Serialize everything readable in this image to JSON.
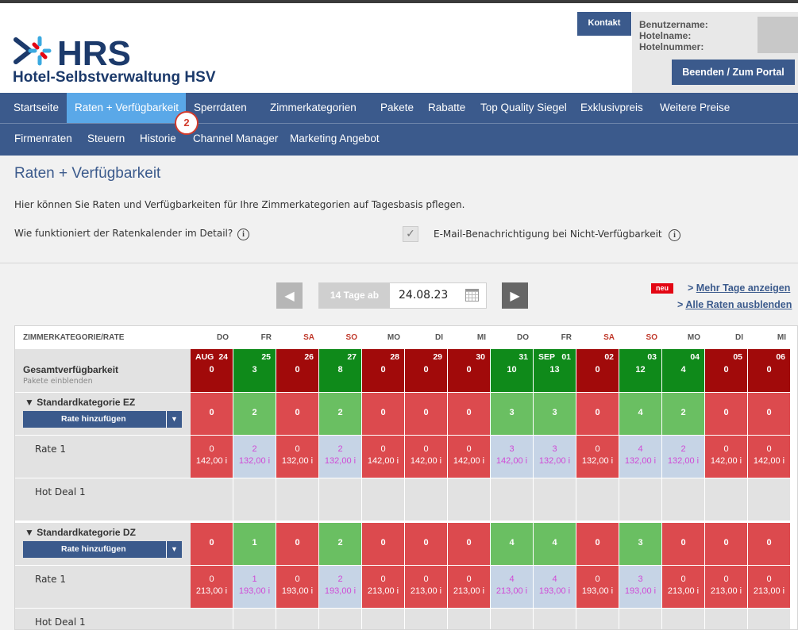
{
  "header": {
    "logo_text": "HRS",
    "brand_title": "Hotel-Selbstverwaltung HSV",
    "kontakt_label": "Kontakt",
    "user_labels": [
      "Benutzername:",
      "Hotelname:",
      "Hotelnummer:"
    ],
    "logout_label": "Beenden / Zum Portal"
  },
  "nav_primary": [
    {
      "label": "Startseite",
      "active": false
    },
    {
      "label": "Raten + Verfügbarkeit",
      "active": true
    },
    {
      "label": "Sperrdaten",
      "active": false
    },
    {
      "label": "Zimmerkategorien",
      "active": false
    },
    {
      "label": "Pakete",
      "active": false
    },
    {
      "label": "Rabatte",
      "active": false
    },
    {
      "label": "Top Quality Siegel",
      "active": false
    },
    {
      "label": "Exklusivpreis",
      "active": false
    },
    {
      "label": "Weitere Preise",
      "active": false
    }
  ],
  "nav_secondary": [
    {
      "label": "Firmenraten"
    },
    {
      "label": "Steuern"
    },
    {
      "label": "Historie"
    },
    {
      "label": "Channel Manager"
    },
    {
      "label": "Marketing Angebot"
    }
  ],
  "step_badge": "2",
  "page": {
    "title": "Raten + Verfügbarkeit",
    "intro": "Hier können Sie Raten und Verfügbarkeiten für Ihre Zimmerkategorien auf Tagesbasis pflegen.",
    "howto": "Wie funktioniert der Ratenkalender im Detail?",
    "email_notify": "E-Mail-Benachrichtigung bei Nicht-Verfügbarkeit",
    "email_notify_checked": true,
    "info_glyph": "i"
  },
  "calendar_controls": {
    "prev_icon": "chevron-left-icon",
    "next_icon": "chevron-right-icon",
    "range_label": "14 Tage ab",
    "start_date": "24.08.23",
    "new_badge": "neu",
    "more_days": "Mehr Tage anzeigen",
    "hide_rates": "Alle Raten ausblenden",
    "link_prefix": ">"
  },
  "colors": {
    "nav_bg": "#3b5a8c",
    "nav_active": "#5aa8e8",
    "dark_green": "#0f8a1a",
    "dark_red": "#a10a0a",
    "green": "#6abf62",
    "red": "#dc4a4e",
    "light_blue": "#c6d4e6",
    "magenta_text": "#d04ad6"
  },
  "table": {
    "header_label": "ZIMMERKATEGORIE/RATE",
    "days": [
      {
        "wd": "DO",
        "weekend": false,
        "month": "AUG",
        "day": "24",
        "total": "0"
      },
      {
        "wd": "FR",
        "weekend": false,
        "month": "",
        "day": "25",
        "total": "3"
      },
      {
        "wd": "SA",
        "weekend": true,
        "month": "",
        "day": "26",
        "total": "0"
      },
      {
        "wd": "SO",
        "weekend": true,
        "month": "",
        "day": "27",
        "total": "8"
      },
      {
        "wd": "MO",
        "weekend": false,
        "month": "",
        "day": "28",
        "total": "0"
      },
      {
        "wd": "DI",
        "weekend": false,
        "month": "",
        "day": "29",
        "total": "0"
      },
      {
        "wd": "MI",
        "weekend": false,
        "month": "",
        "day": "30",
        "total": "0"
      },
      {
        "wd": "DO",
        "weekend": false,
        "month": "",
        "day": "31",
        "total": "10"
      },
      {
        "wd": "FR",
        "weekend": false,
        "month": "SEP",
        "day": "01",
        "total": "13"
      },
      {
        "wd": "SA",
        "weekend": true,
        "month": "",
        "day": "02",
        "total": "0"
      },
      {
        "wd": "SO",
        "weekend": true,
        "month": "",
        "day": "03",
        "total": "12"
      },
      {
        "wd": "MO",
        "weekend": false,
        "month": "",
        "day": "04",
        "total": "4"
      },
      {
        "wd": "DI",
        "weekend": false,
        "month": "",
        "day": "05",
        "total": "0"
      },
      {
        "wd": "MI",
        "weekend": false,
        "month": "",
        "day": "06",
        "total": "0"
      }
    ],
    "total_label": "Gesamtverfügbarkeit",
    "packages_label": "Pakete einblenden",
    "categories": [
      {
        "name": "▼ Standardkategorie EZ",
        "add_rate_label": "Rate hinzufügen",
        "dropdown_glyph": "▼",
        "availability": [
          "0",
          "2",
          "0",
          "2",
          "0",
          "0",
          "0",
          "3",
          "3",
          "0",
          "4",
          "2",
          "0",
          "0"
        ],
        "rates": [
          {
            "label": "Rate 1",
            "counts": [
              "0",
              "2",
              "0",
              "2",
              "0",
              "0",
              "0",
              "3",
              "3",
              "0",
              "4",
              "2",
              "0",
              "0"
            ],
            "prices": [
              "142,00 i",
              "132,00 i",
              "132,00 i",
              "132,00 i",
              "142,00 i",
              "142,00 i",
              "142,00 i",
              "142,00 i",
              "132,00 i",
              "132,00 i",
              "132,00 i",
              "132,00 i",
              "142,00 i",
              "142,00 i"
            ]
          },
          {
            "label": "Hot Deal 1",
            "counts": [],
            "prices": []
          }
        ]
      },
      {
        "name": "▼ Standardkategorie DZ",
        "add_rate_label": "Rate hinzufügen",
        "dropdown_glyph": "▼",
        "availability": [
          "0",
          "1",
          "0",
          "2",
          "0",
          "0",
          "0",
          "4",
          "4",
          "0",
          "3",
          "0",
          "0",
          "0"
        ],
        "rates": [
          {
            "label": "Rate 1",
            "counts": [
              "0",
              "1",
              "0",
              "2",
              "0",
              "0",
              "0",
              "4",
              "4",
              "0",
              "3",
              "0",
              "0",
              "0"
            ],
            "prices": [
              "213,00 i",
              "193,00 i",
              "193,00 i",
              "193,00 i",
              "213,00 i",
              "213,00 i",
              "213,00 i",
              "213,00 i",
              "193,00 i",
              "193,00 i",
              "193,00 i",
              "213,00 i",
              "213,00 i",
              "213,00 i"
            ]
          },
          {
            "label": "Hot Deal 1",
            "counts": [],
            "prices": []
          }
        ]
      }
    ]
  }
}
